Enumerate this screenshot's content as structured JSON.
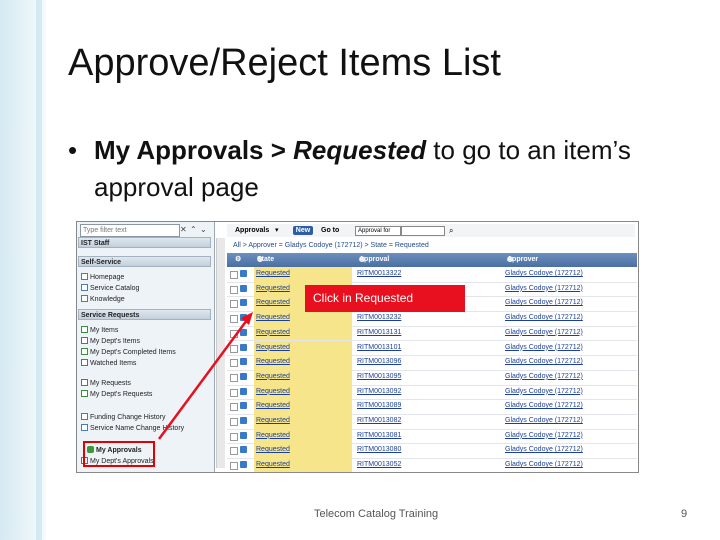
{
  "slide": {
    "title": "Approve/Reject Items List",
    "bullet_marker": "•",
    "bullet_bold": "My Approvals > ",
    "bullet_bold_italic": "Requested",
    "bullet_rest": "  to go to an item’s approval page",
    "footer_text": "Telecom Catalog Training",
    "page_number": "9"
  },
  "nav": {
    "filter_placeholder": "Type filter text",
    "sections": [
      {
        "header": "IST Staff",
        "items": []
      },
      {
        "header": "Self-Service",
        "items": [
          "Homepage",
          "Service Catalog",
          "Knowledge"
        ]
      },
      {
        "header": "Service Requests",
        "items": [
          "My Items",
          "My Dept's Items",
          "My Dept's Completed Items",
          "Watched Items",
          "My Requests",
          "My Dept's Requests",
          "Funding Change History",
          "Service Name Change History",
          "My Approvals",
          "My Dept's Approvals"
        ]
      }
    ]
  },
  "list": {
    "title": "Approvals",
    "new_label": "New",
    "goto_label": "Go to",
    "goto_select": "Approval for",
    "breadcrumb": "All > Approver = Gladys Codoye (172712) > State = Requested",
    "columns": [
      "State",
      "Approval for",
      "Approver"
    ],
    "rows": [
      {
        "state": "Requested",
        "approval_for": "RITM0013322",
        "approver": "Gladys Codoye (172712)"
      },
      {
        "state": "Requested",
        "approval_for": "",
        "approver": "Gladys Codoye (172712)"
      },
      {
        "state": "Requested",
        "approval_for": "",
        "approver": "Gladys Codoye (172712)"
      },
      {
        "state": "Requested",
        "approval_for": "RITM0013232",
        "approver": "Gladys Codoye (172712)"
      },
      {
        "state": "Requested",
        "approval_for": "RITM0013131",
        "approver": "Gladys Codoye (172712)"
      },
      {
        "state": "Requested",
        "approval_for": "RITM0013101",
        "approver": "Gladys Codoye (172712)"
      },
      {
        "state": "Requested",
        "approval_for": "RITM0013096",
        "approver": "Gladys Codoye (172712)"
      },
      {
        "state": "Requested",
        "approval_for": "RITM0013095",
        "approver": "Gladys Codoye (172712)"
      },
      {
        "state": "Requested",
        "approval_for": "RITM0013092",
        "approver": "Gladys Codoye (172712)"
      },
      {
        "state": "Requested",
        "approval_for": "RITM0013089",
        "approver": "Gladys Codoye (172712)"
      },
      {
        "state": "Requested",
        "approval_for": "RITM0013082",
        "approver": "Gladys Codoye (172712)"
      },
      {
        "state": "Requested",
        "approval_for": "RITM0013081",
        "approver": "Gladys Codoye (172712)"
      },
      {
        "state": "Requested",
        "approval_for": "RITM0013080",
        "approver": "Gladys Codoye (172712)"
      },
      {
        "state": "Requested",
        "approval_for": "RITM0013052",
        "approver": "Gladys Codoye (172712)"
      }
    ],
    "callout": "Click in Requested"
  },
  "colors": {
    "accent_red": "#e8101f",
    "header_blue": "#4a6fa3",
    "state_yellow": "#f6e58a"
  }
}
